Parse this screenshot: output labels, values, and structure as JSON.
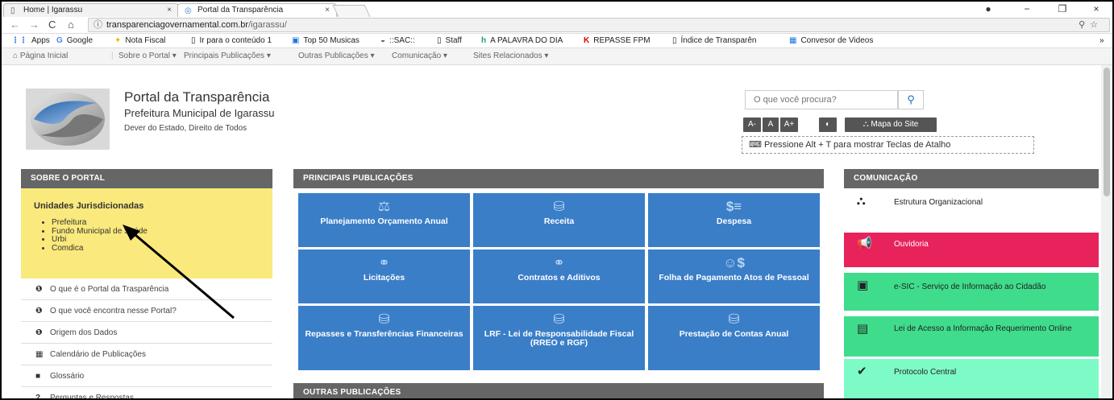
{
  "browser": {
    "tabs": [
      {
        "label": "Home | Igarassu",
        "close": "×"
      },
      {
        "label": "Portal da Transparência",
        "close": "×"
      }
    ],
    "url_host": "transparenciagovernamental.com.br",
    "url_path": "/igarassu/",
    "window_controls": [
      "−",
      "❐",
      "×"
    ],
    "bookmarks": [
      "Apps",
      "Google",
      "Nota Fiscal",
      "Ir para o conteúdo 1",
      "Top 50 Musicas",
      "::SAC::",
      "Staff",
      "A PALAVRA DO DIA",
      "REPASSE FPM",
      "Índice de Transparên",
      "Convesor de Videos"
    ],
    "bookmarks_more": "»"
  },
  "site_nav": {
    "home": "Página Inicial",
    "items": [
      "Sobre o Portal ▾",
      "Principais Publicações ▾",
      "Outras Publicações ▾",
      "Comunicação ▾",
      "Sites Relacionados ▾"
    ]
  },
  "header": {
    "title": "Portal da Transparência",
    "subtitle": "Prefeitura Municipal de Igarassu",
    "slogan": "Dever do Estado, Direito de Todos",
    "search_placeholder": "O que você procura?",
    "tools": [
      "A-",
      "A",
      "A+",
      "◐",
      "Mapa do Site"
    ],
    "shortcut_hint": "Pressione Alt + T para mostrar Teclas de Atalho"
  },
  "left_panel": {
    "heading": "SOBRE O PORTAL",
    "unidades_title": "Unidades Jurisdicionadas",
    "unidades": [
      "Prefeitura",
      "Fundo Municipal de Saúde",
      "Urbi",
      "Comdica"
    ],
    "links": [
      "O que é o Portal da Trasparência",
      "O que você encontra nesse Portal?",
      "Origem dos Dados",
      "Calendário de Publicações",
      "Glossário",
      "Perguntas e Respostas"
    ]
  },
  "center_panel": {
    "heading": "PRINCIPAIS PUBLICAÇÕES",
    "tiles": [
      "Planejamento Orçamento Anual",
      "Receita",
      "Despesa",
      "Licitações",
      "Contratos e Aditivos",
      "Folha de Pagamento Atos de Pessoal",
      "Repasses e Transferências Financeiras",
      "LRF - Lei de Responsabilidade Fiscal (RREO e RGF)",
      "Prestação de Contas Anual"
    ],
    "outras_heading": "OUTRAS PUBLICAÇÕES"
  },
  "right_panel": {
    "heading": "COMUNICAÇÃO",
    "items": [
      {
        "label": "Estrutura Organizacional",
        "color": "#ffffff"
      },
      {
        "label": "Ouvidoria",
        "color": "#e8235c"
      },
      {
        "label": "e-SIC - Serviço de Informação ao Cidadão",
        "color": "#3fdc8c"
      },
      {
        "label": "Lei de Acesso a Informação Requerimento Online",
        "color": "#3fdc8c"
      },
      {
        "label": "Protocolo Central",
        "color": "#7dfbc6"
      }
    ]
  },
  "colors": {
    "tile_blue": "#3a7ec8",
    "unidades_yellow": "#fae97c",
    "panel_head_gray": "#666666"
  }
}
